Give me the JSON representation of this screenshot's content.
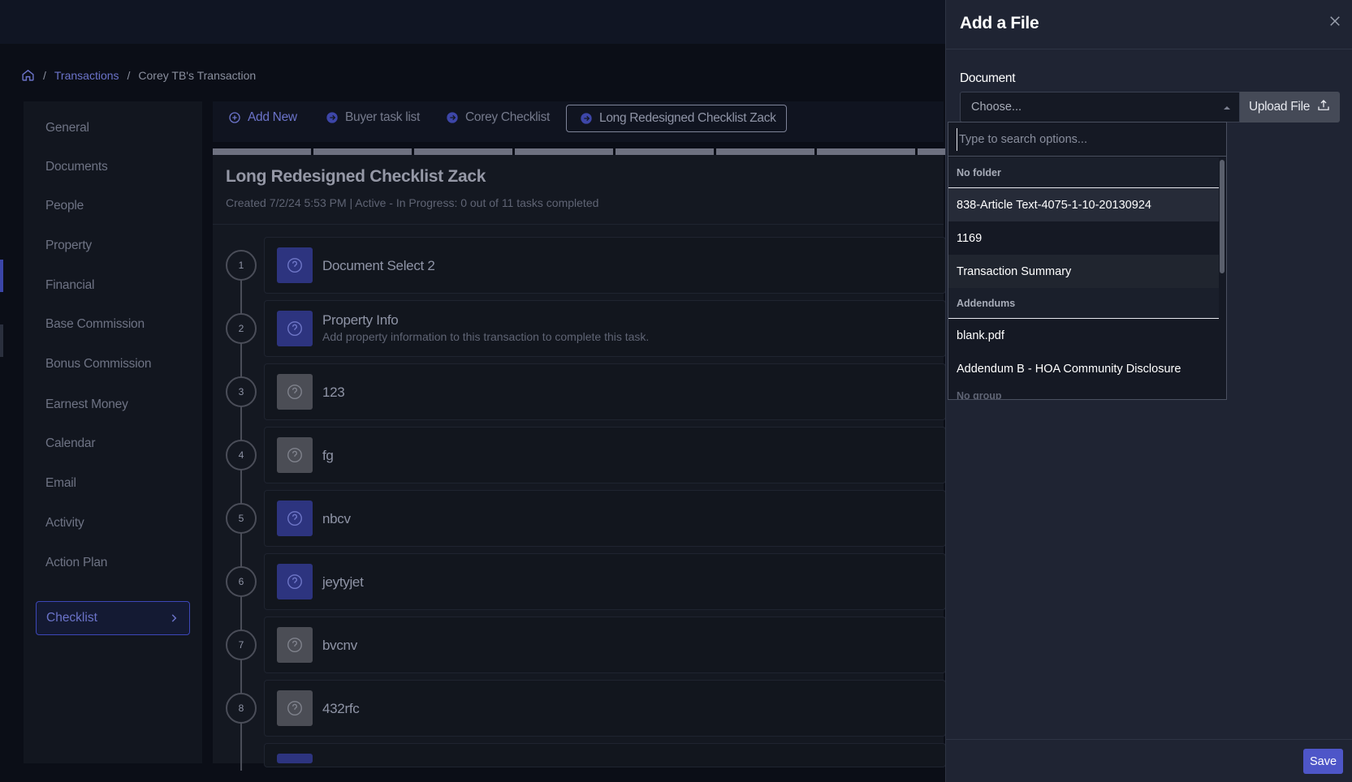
{
  "breadcrumb": {
    "items": [
      "Transactions",
      "Corey TB's Transaction"
    ],
    "separator": "/"
  },
  "sidebar": {
    "items": [
      {
        "label": "General"
      },
      {
        "label": "Documents"
      },
      {
        "label": "People"
      },
      {
        "label": "Property"
      },
      {
        "label": "Financial"
      },
      {
        "label": "Base Commission"
      },
      {
        "label": "Bonus Commission"
      },
      {
        "label": "Earnest Money"
      },
      {
        "label": "Calendar"
      },
      {
        "label": "Email"
      },
      {
        "label": "Activity"
      },
      {
        "label": "Action Plan"
      }
    ],
    "active": "Checklist"
  },
  "tabs": {
    "add_new": "Add New",
    "items": [
      "Buyer task list",
      "Corey Checklist"
    ],
    "active": "Long Redesigned Checklist Zack"
  },
  "checklist": {
    "title": "Long Redesigned Checklist Zack",
    "meta": "Created 7/2/24 5:53 PM  |  Active - In Progress: 0 out of 11 tasks completed",
    "tasks": [
      {
        "num": "1",
        "title": "Document Select 2",
        "subtitle": "",
        "style": "blue"
      },
      {
        "num": "2",
        "title": "Property Info",
        "subtitle": "Add property information to this transaction to complete this task.",
        "style": "blue"
      },
      {
        "num": "3",
        "title": "123",
        "subtitle": "",
        "style": "grey"
      },
      {
        "num": "4",
        "title": "fg",
        "subtitle": "",
        "style": "grey"
      },
      {
        "num": "5",
        "title": "nbcv",
        "subtitle": "",
        "style": "blue"
      },
      {
        "num": "6",
        "title": "jeytyjet",
        "subtitle": "",
        "style": "blue"
      },
      {
        "num": "7",
        "title": "bvcnv",
        "subtitle": "",
        "style": "grey"
      },
      {
        "num": "8",
        "title": "432rfc",
        "subtitle": "",
        "style": "grey"
      }
    ]
  },
  "drawer": {
    "title": "Add a File",
    "document_label": "Document",
    "select_placeholder": "Choose...",
    "upload_label": "Upload File",
    "save_label": "Save"
  },
  "dropdown": {
    "search_placeholder": "Type to search options...",
    "groups": [
      {
        "label": "No folder",
        "options": [
          "838-Article Text-4075-1-10-20130924",
          "1169",
          "Transaction Summary"
        ]
      },
      {
        "label": "Addendums",
        "options": [
          "blank.pdf",
          "Addendum B - HOA Community Disclosure"
        ]
      }
    ],
    "next_group_partial": "No group"
  },
  "colors": {
    "accent": "#4e56c8",
    "link": "#6b73c9",
    "drawer_bg": "#1f2433",
    "page_bg": "#0b0e17"
  }
}
